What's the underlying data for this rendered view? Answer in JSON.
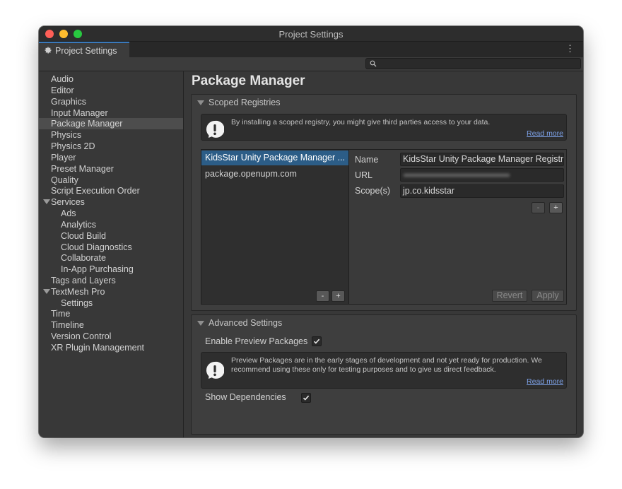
{
  "window": {
    "title": "Project Settings"
  },
  "tab": {
    "label": "Project Settings",
    "icon": "gear-icon"
  },
  "search": {
    "placeholder": "",
    "icon": "search-icon"
  },
  "sidebar": {
    "items": [
      {
        "label": "Audio"
      },
      {
        "label": "Editor"
      },
      {
        "label": "Graphics"
      },
      {
        "label": "Input Manager"
      },
      {
        "label": "Package Manager",
        "selected": true
      },
      {
        "label": "Physics"
      },
      {
        "label": "Physics 2D"
      },
      {
        "label": "Player"
      },
      {
        "label": "Preset Manager"
      },
      {
        "label": "Quality"
      },
      {
        "label": "Script Execution Order"
      },
      {
        "label": "Services",
        "expanded": true
      },
      {
        "label": "Ads"
      },
      {
        "label": "Analytics"
      },
      {
        "label": "Cloud Build"
      },
      {
        "label": "Cloud Diagnostics"
      },
      {
        "label": "Collaborate"
      },
      {
        "label": "In-App Purchasing"
      },
      {
        "label": "Tags and Layers"
      },
      {
        "label": "TextMesh Pro",
        "expanded": true
      },
      {
        "label": "Settings"
      },
      {
        "label": "Time"
      },
      {
        "label": "Timeline"
      },
      {
        "label": "Version Control"
      },
      {
        "label": "XR Plugin Management"
      }
    ]
  },
  "main": {
    "title": "Package Manager",
    "scoped": {
      "header": "Scoped Registries",
      "warning": "By installing a scoped registry, you might give third parties access to your data.",
      "read_more": "Read more",
      "registries": [
        {
          "label": "KidsStar Unity Package Manager ...",
          "selected": true
        },
        {
          "label": "package.openupm.com"
        }
      ],
      "list_remove": "-",
      "list_add": "+",
      "name_label": "Name",
      "name_value": "KidsStar Unity Package Manager Registr",
      "url_label": "URL",
      "url_value": "",
      "scope_label": "Scope(s)",
      "scope_value": "jp.co.kidsstar",
      "scope_remove": "-",
      "scope_add": "+",
      "revert": "Revert",
      "apply": "Apply"
    },
    "advanced": {
      "header": "Advanced Settings",
      "preview_label": "Enable Preview Packages",
      "preview_checked": true,
      "preview_info": "Preview Packages are in the early stages of development and not yet ready for production. We recommend using these only for testing purposes and to give us direct feedback.",
      "read_more": "Read more",
      "deps_label": "Show Dependencies",
      "deps_checked": true
    }
  },
  "colors": {
    "selection": "#2c5d87",
    "link": "#7ca0e6",
    "tab_accent": "#3a79bb"
  }
}
